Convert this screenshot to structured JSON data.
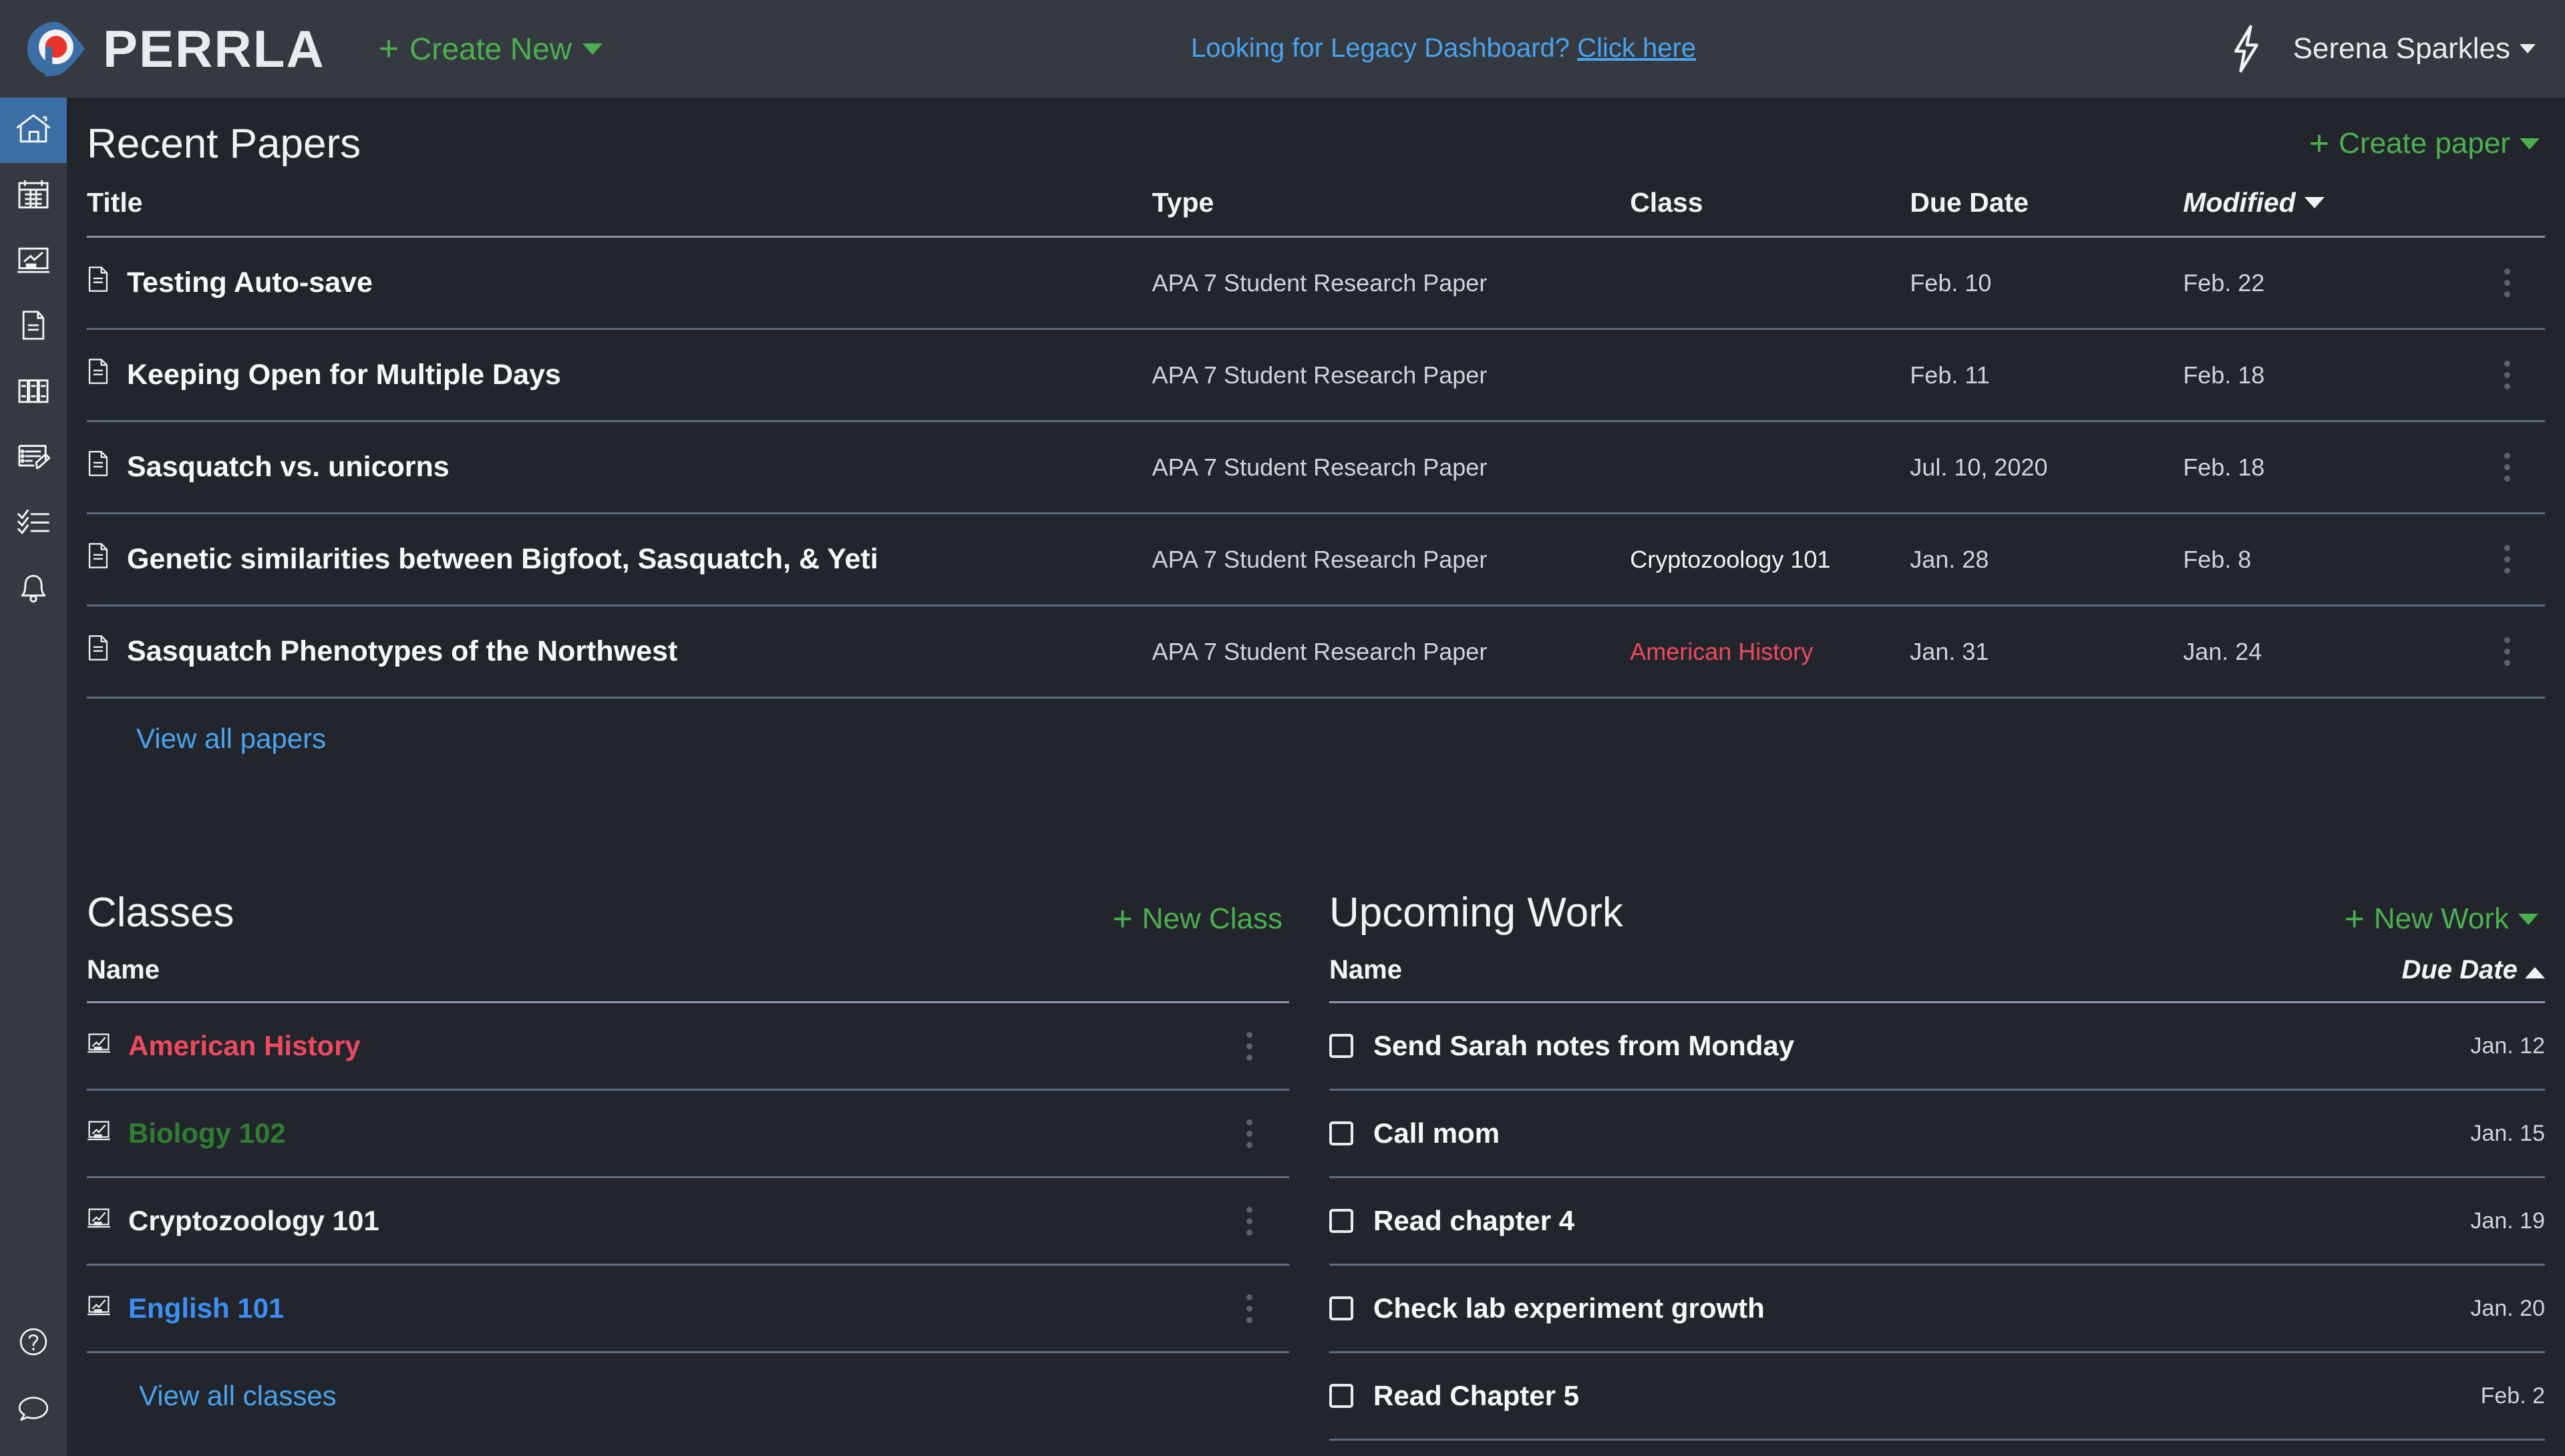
{
  "brand": {
    "name": "PERRLA",
    "logo_icon": "perrla-eye-logo"
  },
  "topbar": {
    "create_new_label": "Create New",
    "create_new_icon": "plus-icon",
    "legacy_prompt": "Looking for Legacy Dashboard?",
    "legacy_link": "Click here",
    "bolt_icon": "lightning-bolt-icon",
    "user_name": "Serena Sparkles"
  },
  "sidebar": {
    "items": [
      {
        "icon": "home-icon",
        "name": "sidebar-item-home",
        "active": true
      },
      {
        "icon": "calendar-icon",
        "name": "sidebar-item-calendar",
        "active": false
      },
      {
        "icon": "presentation-chart-icon",
        "name": "sidebar-item-classes",
        "active": false
      },
      {
        "icon": "document-icon",
        "name": "sidebar-item-papers",
        "active": false
      },
      {
        "icon": "books-icon",
        "name": "sidebar-item-references",
        "active": false
      },
      {
        "icon": "notes-pencil-icon",
        "name": "sidebar-item-notes",
        "active": false
      },
      {
        "icon": "checklist-icon",
        "name": "sidebar-item-tasks",
        "active": false
      },
      {
        "icon": "bell-icon",
        "name": "sidebar-item-reminders",
        "active": false
      }
    ],
    "bottom_items": [
      {
        "icon": "help-circle-icon",
        "name": "sidebar-item-help"
      },
      {
        "icon": "chat-bubble-icon",
        "name": "sidebar-item-feedback"
      }
    ]
  },
  "papers": {
    "title": "Recent Papers",
    "create_label": "Create paper",
    "create_icon": "plus-icon",
    "columns": [
      "Title",
      "Type",
      "Class",
      "Due Date",
      "Modified"
    ],
    "sort_column": "Modified",
    "sort_direction": "desc",
    "rows": [
      {
        "title": "Testing Auto-save",
        "type": "APA 7 Student Research Paper",
        "class": "",
        "class_color": "",
        "due": "Feb. 10",
        "modified": "Feb. 22"
      },
      {
        "title": "Keeping Open for Multiple Days",
        "type": "APA 7 Student Research Paper",
        "class": "",
        "class_color": "",
        "due": "Feb. 11",
        "modified": "Feb. 18"
      },
      {
        "title": "Sasquatch vs. unicorns",
        "type": "APA 7 Student Research Paper",
        "class": "",
        "class_color": "",
        "due": "Jul. 10, 2020",
        "modified": "Feb. 18"
      },
      {
        "title": "Genetic similarities between Bigfoot, Sasquatch, & Yeti",
        "type": "APA 7 Student Research Paper",
        "class": "Cryptozoology 101",
        "class_color": "#f1f3f5",
        "due": "Jan. 28",
        "modified": "Feb. 8"
      },
      {
        "title": "Sasquatch Phenotypes of the Northwest",
        "type": "APA 7 Student Research Paper",
        "class": "American History",
        "class_color": "#ef495f",
        "due": "Jan. 31",
        "modified": "Jan. 24"
      }
    ],
    "view_all_label": "View all papers",
    "row_menu_icon": "kebab-menu-icon",
    "doc_icon": "document-icon"
  },
  "classes": {
    "title": "Classes",
    "new_label": "New Class",
    "new_icon": "plus-icon",
    "columns": [
      "Name"
    ],
    "rows": [
      {
        "name": "American History",
        "color": "#ef495f"
      },
      {
        "name": "Biology 102",
        "color": "#2f7d32"
      },
      {
        "name": "Cryptozoology 101",
        "color": "#f1f3f5"
      },
      {
        "name": "English 101",
        "color": "#3d8ef5"
      }
    ],
    "view_all_label": "View all classes",
    "class_icon": "presentation-chart-icon",
    "row_menu_icon": "kebab-menu-icon"
  },
  "work": {
    "title": "Upcoming Work",
    "new_label": "New Work",
    "new_icon": "plus-icon",
    "columns": [
      "Name",
      "Due Date"
    ],
    "sort_column": "Due Date",
    "sort_direction": "asc",
    "rows": [
      {
        "name": "Send Sarah notes from Monday",
        "due": "Jan. 12",
        "checked": false
      },
      {
        "name": "Call mom",
        "due": "Jan. 15",
        "checked": false
      },
      {
        "name": "Read chapter 4",
        "due": "Jan. 19",
        "checked": false
      },
      {
        "name": "Check lab experiment growth",
        "due": "Jan. 20",
        "checked": false
      },
      {
        "name": "Read Chapter 5",
        "due": "Feb. 2",
        "checked": false
      }
    ],
    "checkbox_icon": "checkbox-icon"
  },
  "colors": {
    "page_bg": "#22262c",
    "chrome_bg": "#343a40",
    "accent_green": "#4caf50",
    "accent_blue": "#4aa3ef",
    "active_blue": "#3a6ea5",
    "danger_red": "#ef495f",
    "text_primary": "#f1f3f5",
    "text_muted": "#ced4da",
    "divider": "#5d6b80"
  }
}
